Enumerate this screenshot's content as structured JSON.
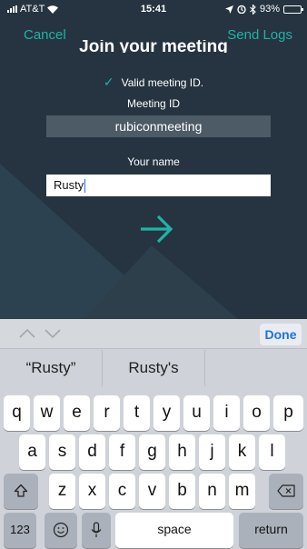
{
  "status_bar": {
    "carrier": "AT&T",
    "time": "15:41",
    "battery": "93%",
    "battery_level": 0.93
  },
  "nav": {
    "cancel": "Cancel",
    "send_logs": "Send Logs",
    "title_clipped": "Join your meeting"
  },
  "form": {
    "validation": "Valid meeting ID.",
    "meeting_id_label": "Meeting ID",
    "meeting_id_value": "rubiconmeeting",
    "name_label": "Your name",
    "name_value": "Rusty"
  },
  "keyboard": {
    "done": "Done",
    "suggestions": [
      "“Rusty”",
      "Rusty's",
      ""
    ],
    "row1": [
      "q",
      "w",
      "e",
      "r",
      "t",
      "y",
      "u",
      "i",
      "o",
      "p"
    ],
    "row2": [
      "a",
      "s",
      "d",
      "f",
      "g",
      "h",
      "j",
      "k",
      "l"
    ],
    "row3": [
      "z",
      "x",
      "c",
      "v",
      "b",
      "n",
      "m"
    ],
    "numbers": "123",
    "space": "space",
    "return": "return"
  },
  "colors": {
    "accent": "#1fb3a8",
    "background": "#253440",
    "ios_blue": "#1a73e8"
  }
}
